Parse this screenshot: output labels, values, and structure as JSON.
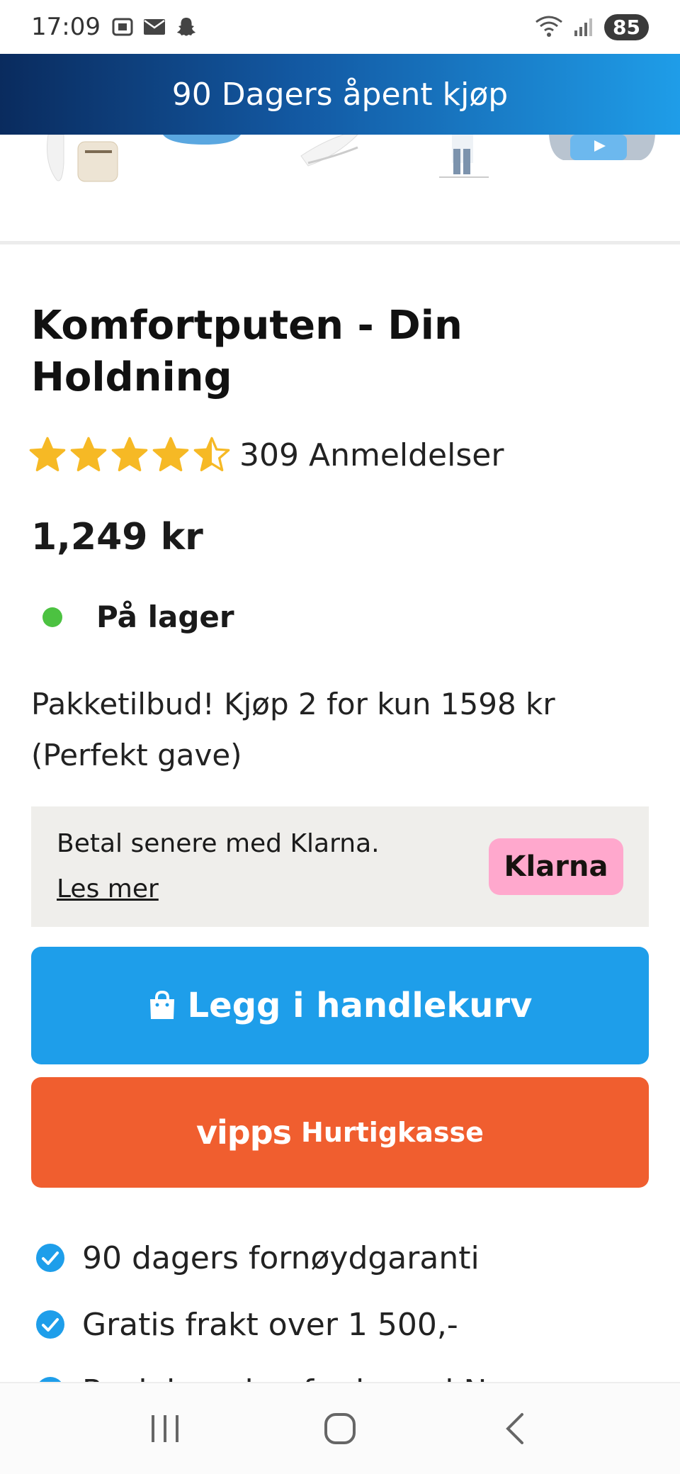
{
  "status_bar": {
    "time": "17:09",
    "battery": "85"
  },
  "promo_banner": {
    "text": "90 Dagers åpent kjøp"
  },
  "product": {
    "title": "Komfortputen - Din Holdning",
    "rating": 4.5,
    "rating_max": 5,
    "review_count": "309 Anmeldelser",
    "price": "1,249 kr",
    "stock_status": "På lager",
    "bundle_offer": "Pakketilbud! Kjøp 2 for kun 1598 kr (Perfekt gave)"
  },
  "klarna": {
    "text": "Betal senere med Klarna.",
    "link": "Les mer",
    "badge": "Klarna"
  },
  "buttons": {
    "add_to_cart": "Legg i handlekurv",
    "vipps_logo": "vipps",
    "vipps_label": "Hurtigkasse"
  },
  "benefits": [
    "90 dagers fornøydgaranti",
    "Gratis frakt over 1 500,-",
    "Rask levering fra lager i Norge"
  ],
  "colors": {
    "brand_blue": "#1e9eea",
    "vipps_orange": "#f05e2f",
    "star_yellow": "#f6b925",
    "stock_green": "#4cc241",
    "klarna_pink": "#ffa8cd"
  }
}
